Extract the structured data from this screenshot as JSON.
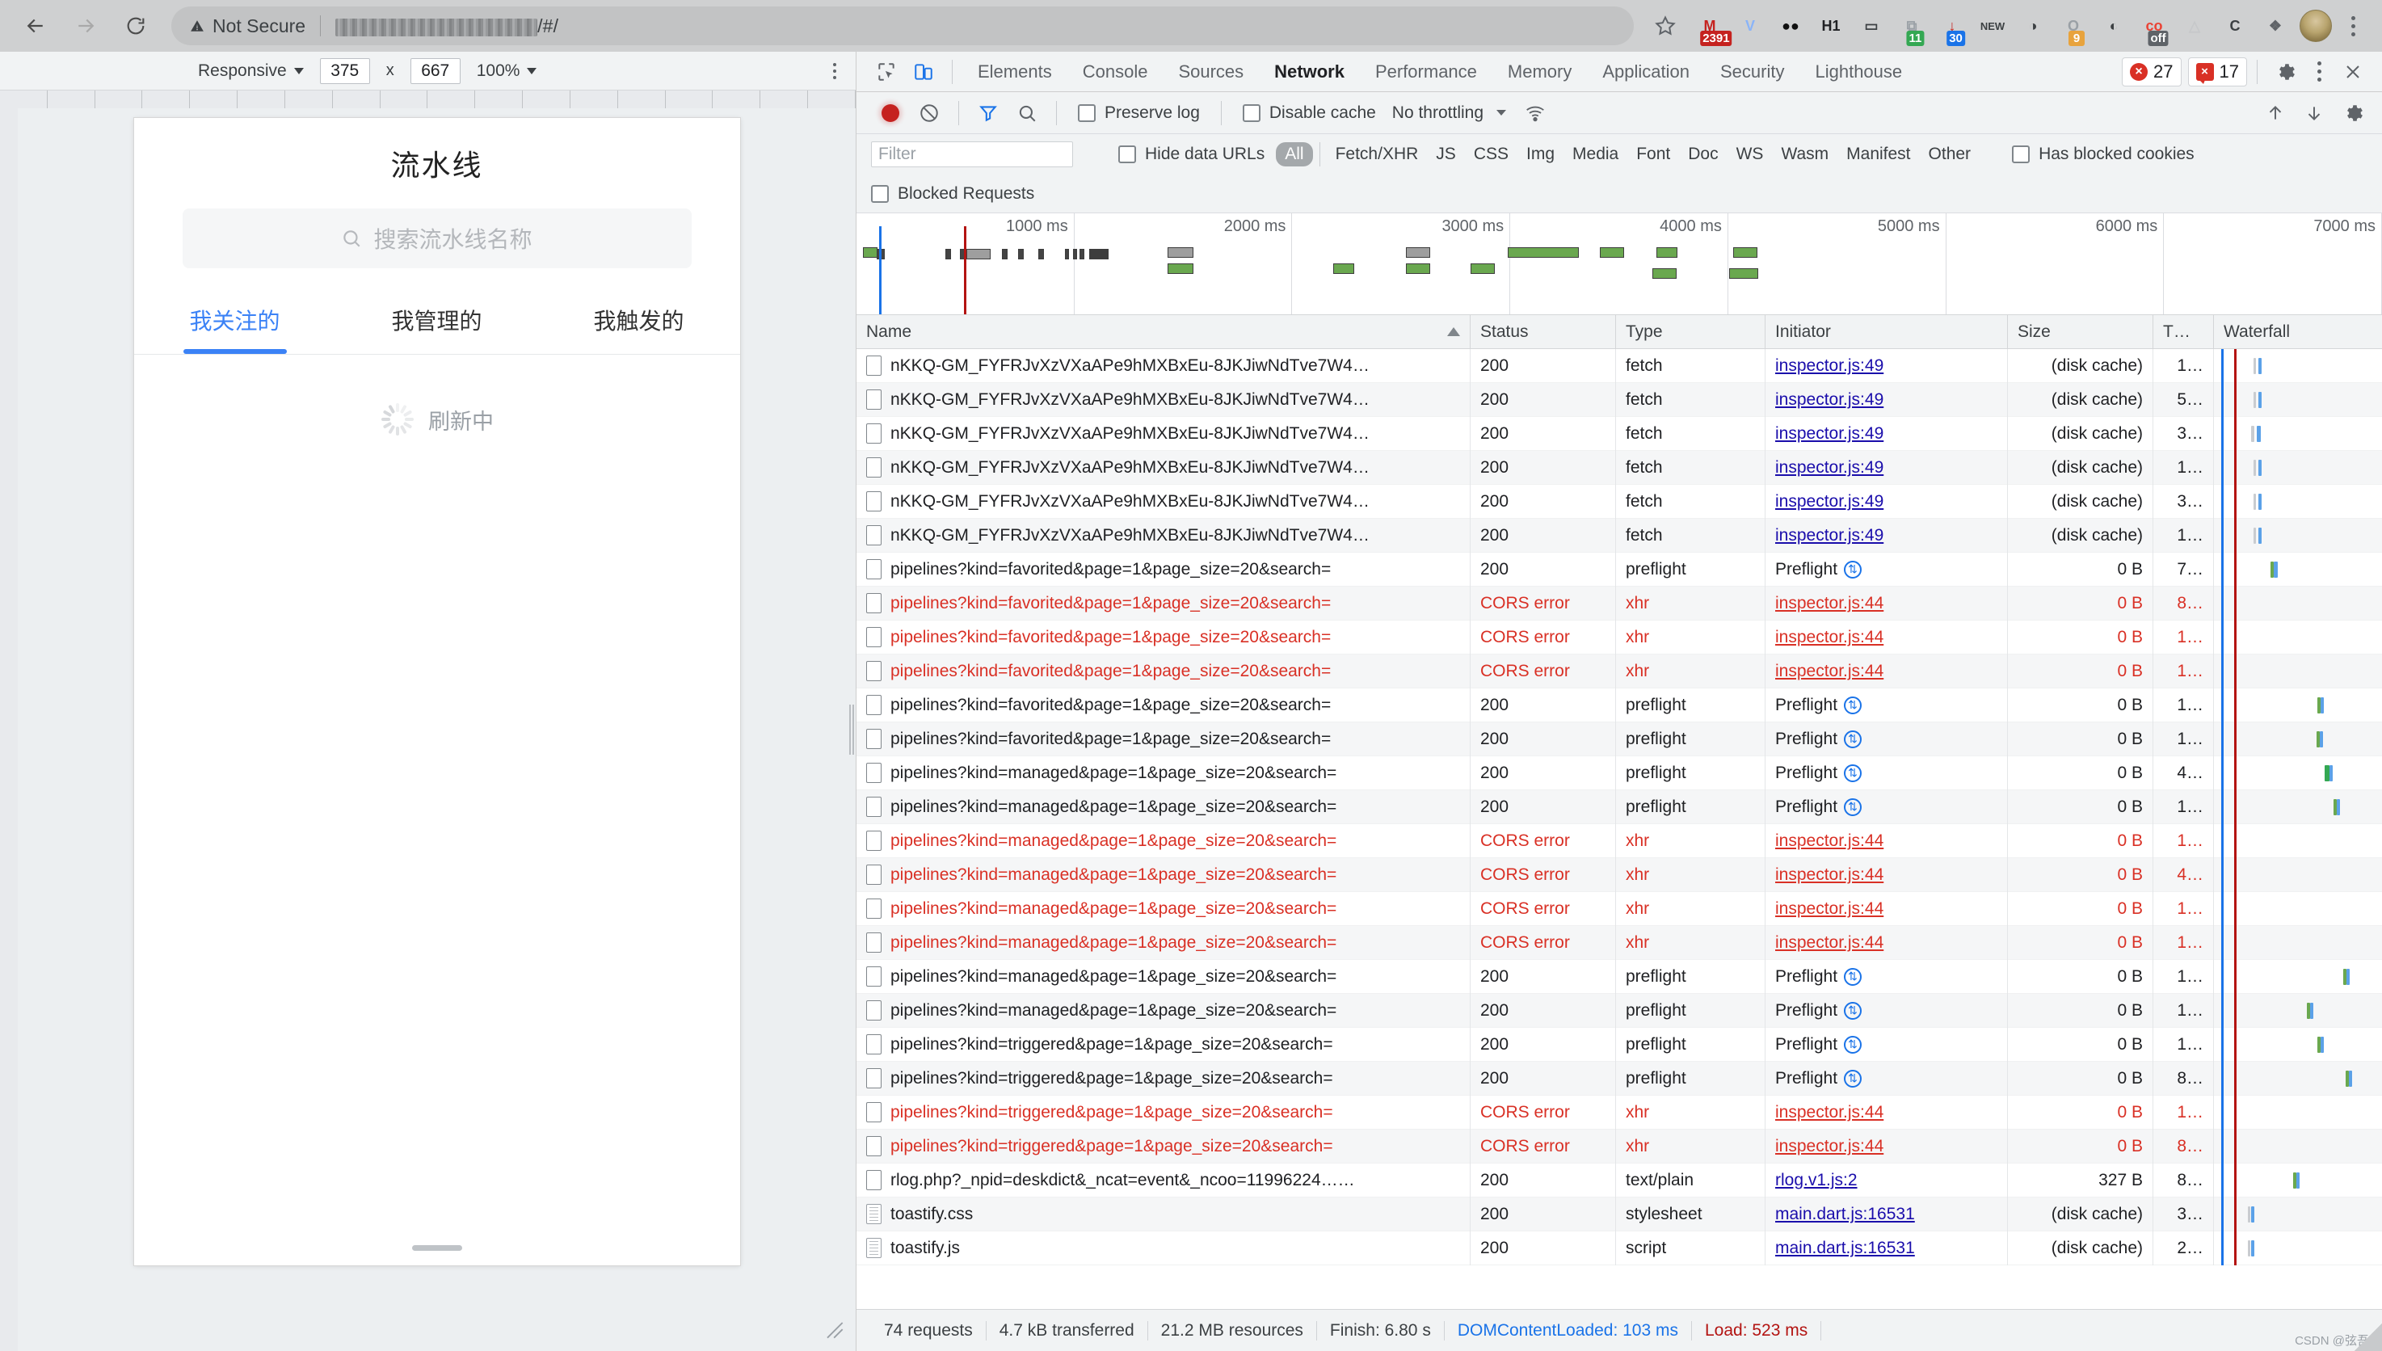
{
  "browser": {
    "back_icon": "arrow-left-icon",
    "forward_icon": "arrow-right-icon",
    "reload_icon": "reload-icon",
    "security_label": "Not Secure",
    "url_suffix": "/#/",
    "url_redacted": true,
    "star_icon": "bookmark-star-icon",
    "extensions": [
      {
        "name": "gmail-extension",
        "glyph": "M",
        "badge": "2391",
        "badge_color": "#c5221f",
        "icon_color": "#c5221f"
      },
      {
        "name": "shield-extension",
        "glyph": "V",
        "badge": "",
        "badge_color": "",
        "icon_color": "#8ab4f8"
      },
      {
        "name": "eyes-extension",
        "glyph": "●●",
        "badge": "",
        "badge_color": "",
        "icon_color": "#111111"
      },
      {
        "name": "h1-extension",
        "glyph": "H1",
        "badge": "",
        "badge_color": "",
        "icon_color": "#202124"
      },
      {
        "name": "mobile-extension",
        "glyph": "▭",
        "badge": "",
        "badge_color": "",
        "icon_color": "#3c4043"
      },
      {
        "name": "copy-extension",
        "glyph": "⧉",
        "badge": "11",
        "badge_color": "#34a853",
        "icon_color": "#9aa0a6"
      },
      {
        "name": "download-extension",
        "glyph": "↓",
        "badge": "30",
        "badge_color": "#1a73e8",
        "icon_color": "#c5221f"
      },
      {
        "name": "new-capture-extension",
        "glyph": "NEW",
        "badge": "",
        "badge_color": "",
        "icon_color": "#3c4043"
      },
      {
        "name": "mask-extension",
        "glyph": "◑",
        "badge": "",
        "badge_color": "",
        "icon_color": "#3c4043"
      },
      {
        "name": "opera-extension",
        "glyph": "O",
        "badge": "9",
        "badge_color": "#e8a33d",
        "icon_color": "#9aa0a6"
      },
      {
        "name": "dark-reader-extension",
        "glyph": "◐",
        "badge": "",
        "badge_color": "",
        "icon_color": "#3c4043"
      },
      {
        "name": "colorpick-extension",
        "glyph": "co",
        "badge": "off",
        "badge_color": "#5f6368",
        "icon_color": "#ea4335"
      },
      {
        "name": "triangle-extension",
        "glyph": "△",
        "badge": "",
        "badge_color": "",
        "icon_color": "#c6c8ca"
      },
      {
        "name": "clear-cache-extension",
        "glyph": "C",
        "badge": "",
        "badge_color": "",
        "icon_color": "#3c4043"
      },
      {
        "name": "puzzle-extension",
        "glyph": "❖",
        "badge": "",
        "badge_color": "",
        "icon_color": "#5f6368"
      }
    ],
    "menu_icon": "kebab-menu-icon",
    "profile_icon": "profile-avatar-icon"
  },
  "device_toolbar": {
    "device_label": "Responsive",
    "width": "375",
    "x_label": "x",
    "height": "667",
    "zoom": "100%",
    "more_icon": "device-more-options-icon"
  },
  "page": {
    "title": "流水线",
    "search_placeholder": "搜索流水线名称",
    "search_icon": "search-icon",
    "tabs": [
      {
        "label": "我关注的",
        "active": true
      },
      {
        "label": "我管理的",
        "active": false
      },
      {
        "label": "我触发的",
        "active": false
      }
    ],
    "loading_text": "刷新中",
    "accent_color": "#3b82f6"
  },
  "devtools": {
    "inspect_icon": "inspect-element-icon",
    "device_toggle_icon": "toggle-device-toolbar-icon",
    "tabs": [
      {
        "label": "Elements",
        "selected": false
      },
      {
        "label": "Console",
        "selected": false
      },
      {
        "label": "Sources",
        "selected": false
      },
      {
        "label": "Network",
        "selected": true
      },
      {
        "label": "Performance",
        "selected": false
      },
      {
        "label": "Memory",
        "selected": false
      },
      {
        "label": "Application",
        "selected": false
      },
      {
        "label": "Security",
        "selected": false
      },
      {
        "label": "Lighthouse",
        "selected": false
      }
    ],
    "error_count": "27",
    "issue_count": "17",
    "settings_icon": "gear-icon",
    "more_icon": "devtools-more-icon",
    "close_icon": "close-icon"
  },
  "network_toolbar": {
    "record_icon": "record-stop-icon",
    "clear_icon": "clear-network-log-icon",
    "filter_icon": "filter-funnel-icon",
    "search_icon": "search-icon",
    "preserve_log_label": "Preserve log",
    "preserve_log_checked": false,
    "disable_cache_label": "Disable cache",
    "disable_cache_checked": false,
    "throttling_value": "No throttling",
    "wifi_icon": "network-conditions-icon",
    "import_icon": "import-har-icon",
    "export_icon": "export-har-icon",
    "settings_icon": "network-settings-icon"
  },
  "filter_bar": {
    "filter_placeholder": "Filter",
    "hide_data_urls_label": "Hide data URLs",
    "hide_data_urls_checked": false,
    "types": [
      "All",
      "Fetch/XHR",
      "JS",
      "CSS",
      "Img",
      "Media",
      "Font",
      "Doc",
      "WS",
      "Wasm",
      "Manifest",
      "Other"
    ],
    "active_type": "All",
    "has_blocked_cookies_label": "Has blocked cookies",
    "has_blocked_cookies_checked": false,
    "blocked_requests_label": "Blocked Requests",
    "blocked_requests_checked": false
  },
  "overview": {
    "tick_labels": [
      "1000 ms",
      "2000 ms",
      "3000 ms",
      "4000 ms",
      "5000 ms",
      "6000 ms",
      "7000 ms"
    ],
    "dcl_color": "#1a73e8",
    "load_color": "#b31412"
  },
  "table": {
    "columns": [
      "Name",
      "Status",
      "Type",
      "Initiator",
      "Size",
      "T…",
      "Waterfall"
    ],
    "sorted_column": "Name",
    "rows": [
      {
        "name": "nKKQ-GM_FYFRJvXzVXaAPe9hMXBxEu-8JKJiwNdTve7W4…",
        "status": "200",
        "type": "fetch",
        "initiator": "inspector.js:49",
        "initiator_link": true,
        "size": "(disk cache)",
        "time": "1…",
        "error": false,
        "icon": "doc"
      },
      {
        "name": "nKKQ-GM_FYFRJvXzVXaAPe9hMXBxEu-8JKJiwNdTve7W4…",
        "status": "200",
        "type": "fetch",
        "initiator": "inspector.js:49",
        "initiator_link": true,
        "size": "(disk cache)",
        "time": "5…",
        "error": false,
        "icon": "doc"
      },
      {
        "name": "nKKQ-GM_FYFRJvXzVXaAPe9hMXBxEu-8JKJiwNdTve7W4…",
        "status": "200",
        "type": "fetch",
        "initiator": "inspector.js:49",
        "initiator_link": true,
        "size": "(disk cache)",
        "time": "3…",
        "error": false,
        "icon": "doc"
      },
      {
        "name": "nKKQ-GM_FYFRJvXzVXaAPe9hMXBxEu-8JKJiwNdTve7W4…",
        "status": "200",
        "type": "fetch",
        "initiator": "inspector.js:49",
        "initiator_link": true,
        "size": "(disk cache)",
        "time": "1…",
        "error": false,
        "icon": "doc"
      },
      {
        "name": "nKKQ-GM_FYFRJvXzVXaAPe9hMXBxEu-8JKJiwNdTve7W4…",
        "status": "200",
        "type": "fetch",
        "initiator": "inspector.js:49",
        "initiator_link": true,
        "size": "(disk cache)",
        "time": "3…",
        "error": false,
        "icon": "doc"
      },
      {
        "name": "nKKQ-GM_FYFRJvXzVXaAPe9hMXBxEu-8JKJiwNdTve7W4…",
        "status": "200",
        "type": "fetch",
        "initiator": "inspector.js:49",
        "initiator_link": true,
        "size": "(disk cache)",
        "time": "1…",
        "error": false,
        "icon": "doc"
      },
      {
        "name": "pipelines?kind=favorited&page=1&page_size=20&search=",
        "status": "200",
        "type": "preflight",
        "initiator": "Preflight",
        "initiator_link": false,
        "preflight": true,
        "size": "0 B",
        "time": "7…",
        "error": false,
        "icon": "doc"
      },
      {
        "name": "pipelines?kind=favorited&page=1&page_size=20&search=",
        "status": "CORS error",
        "type": "xhr",
        "initiator": "inspector.js:44",
        "initiator_link": true,
        "size": "0 B",
        "time": "8…",
        "error": true,
        "icon": "doc"
      },
      {
        "name": "pipelines?kind=favorited&page=1&page_size=20&search=",
        "status": "CORS error",
        "type": "xhr",
        "initiator": "inspector.js:44",
        "initiator_link": true,
        "size": "0 B",
        "time": "1…",
        "error": true,
        "icon": "doc"
      },
      {
        "name": "pipelines?kind=favorited&page=1&page_size=20&search=",
        "status": "CORS error",
        "type": "xhr",
        "initiator": "inspector.js:44",
        "initiator_link": true,
        "size": "0 B",
        "time": "1…",
        "error": true,
        "icon": "doc"
      },
      {
        "name": "pipelines?kind=favorited&page=1&page_size=20&search=",
        "status": "200",
        "type": "preflight",
        "initiator": "Preflight",
        "initiator_link": false,
        "preflight": true,
        "size": "0 B",
        "time": "1…",
        "error": false,
        "icon": "doc"
      },
      {
        "name": "pipelines?kind=favorited&page=1&page_size=20&search=",
        "status": "200",
        "type": "preflight",
        "initiator": "Preflight",
        "initiator_link": false,
        "preflight": true,
        "size": "0 B",
        "time": "1…",
        "error": false,
        "icon": "doc"
      },
      {
        "name": "pipelines?kind=managed&page=1&page_size=20&search=",
        "status": "200",
        "type": "preflight",
        "initiator": "Preflight",
        "initiator_link": false,
        "preflight": true,
        "size": "0 B",
        "time": "4…",
        "error": false,
        "icon": "doc"
      },
      {
        "name": "pipelines?kind=managed&page=1&page_size=20&search=",
        "status": "200",
        "type": "preflight",
        "initiator": "Preflight",
        "initiator_link": false,
        "preflight": true,
        "size": "0 B",
        "time": "1…",
        "error": false,
        "icon": "doc"
      },
      {
        "name": "pipelines?kind=managed&page=1&page_size=20&search=",
        "status": "CORS error",
        "type": "xhr",
        "initiator": "inspector.js:44",
        "initiator_link": true,
        "size": "0 B",
        "time": "1…",
        "error": true,
        "icon": "doc"
      },
      {
        "name": "pipelines?kind=managed&page=1&page_size=20&search=",
        "status": "CORS error",
        "type": "xhr",
        "initiator": "inspector.js:44",
        "initiator_link": true,
        "size": "0 B",
        "time": "4…",
        "error": true,
        "icon": "doc"
      },
      {
        "name": "pipelines?kind=managed&page=1&page_size=20&search=",
        "status": "CORS error",
        "type": "xhr",
        "initiator": "inspector.js:44",
        "initiator_link": true,
        "size": "0 B",
        "time": "1…",
        "error": true,
        "icon": "doc"
      },
      {
        "name": "pipelines?kind=managed&page=1&page_size=20&search=",
        "status": "CORS error",
        "type": "xhr",
        "initiator": "inspector.js:44",
        "initiator_link": true,
        "size": "0 B",
        "time": "1…",
        "error": true,
        "icon": "doc"
      },
      {
        "name": "pipelines?kind=managed&page=1&page_size=20&search=",
        "status": "200",
        "type": "preflight",
        "initiator": "Preflight",
        "initiator_link": false,
        "preflight": true,
        "size": "0 B",
        "time": "1…",
        "error": false,
        "icon": "doc"
      },
      {
        "name": "pipelines?kind=managed&page=1&page_size=20&search=",
        "status": "200",
        "type": "preflight",
        "initiator": "Preflight",
        "initiator_link": false,
        "preflight": true,
        "size": "0 B",
        "time": "1…",
        "error": false,
        "icon": "doc"
      },
      {
        "name": "pipelines?kind=triggered&page=1&page_size=20&search=",
        "status": "200",
        "type": "preflight",
        "initiator": "Preflight",
        "initiator_link": false,
        "preflight": true,
        "size": "0 B",
        "time": "1…",
        "error": false,
        "icon": "doc"
      },
      {
        "name": "pipelines?kind=triggered&page=1&page_size=20&search=",
        "status": "200",
        "type": "preflight",
        "initiator": "Preflight",
        "initiator_link": false,
        "preflight": true,
        "size": "0 B",
        "time": "8…",
        "error": false,
        "icon": "doc"
      },
      {
        "name": "pipelines?kind=triggered&page=1&page_size=20&search=",
        "status": "CORS error",
        "type": "xhr",
        "initiator": "inspector.js:44",
        "initiator_link": true,
        "size": "0 B",
        "time": "1…",
        "error": true,
        "icon": "doc"
      },
      {
        "name": "pipelines?kind=triggered&page=1&page_size=20&search=",
        "status": "CORS error",
        "type": "xhr",
        "initiator": "inspector.js:44",
        "initiator_link": true,
        "size": "0 B",
        "time": "8…",
        "error": true,
        "icon": "doc"
      },
      {
        "name": "rlog.php?_npid=deskdict&_ncat=event&_ncoo=11996224……",
        "status": "200",
        "type": "text/plain",
        "initiator": "rlog.v1.js:2",
        "initiator_link": true,
        "size": "327 B",
        "time": "8…",
        "error": false,
        "icon": "doc"
      },
      {
        "name": "toastify.css",
        "status": "200",
        "type": "stylesheet",
        "initiator": "main.dart.js:16531",
        "initiator_link": true,
        "size": "(disk cache)",
        "time": "3…",
        "error": false,
        "icon": "css"
      },
      {
        "name": "toastify.js",
        "status": "200",
        "type": "script",
        "initiator": "main.dart.js:16531",
        "initiator_link": true,
        "size": "(disk cache)",
        "time": "2…",
        "error": false,
        "icon": "js"
      }
    ]
  },
  "summary": {
    "requests": "74 requests",
    "transferred": "4.7 kB transferred",
    "resources": "21.2 MB resources",
    "finish": "Finish: 6.80 s",
    "dom_content_loaded": "DOMContentLoaded: 103 ms",
    "load": "Load: 523 ms",
    "watermark": "CSDN @弦吾"
  }
}
